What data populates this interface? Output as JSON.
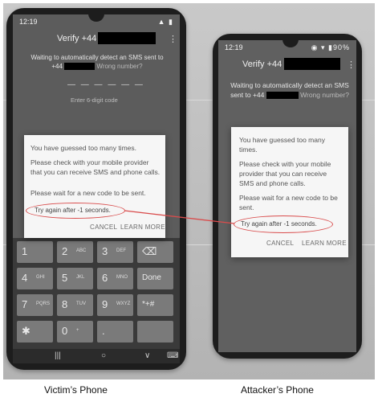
{
  "victim": {
    "status_time": "12:19",
    "status_icons": "▲ ▮",
    "verify_title": "Verify +44",
    "waiting_line1": "Waiting to automatically detect an SMS sent to",
    "waiting_prefix": "+44",
    "waiting_wrong": "Wrong number?",
    "code_dashes": "— — —   — — —",
    "code_hint": "Enter 6-digit code",
    "dialog": {
      "line1": "You have guessed too many times.",
      "line2": "Please check with your mobile provider that you can receive SMS and phone calls.",
      "line3": "Please wait for a new code to be sent.",
      "retry": "Try again after -1 seconds.",
      "cancel": "CANCEL",
      "learn_more": "LEARN MORE"
    },
    "keys": [
      {
        "d": "1",
        "l": ""
      },
      {
        "d": "2",
        "l": "ABC"
      },
      {
        "d": "3",
        "l": "DEF"
      },
      {
        "d": "⌫",
        "l": ""
      },
      {
        "d": "4",
        "l": "GHI"
      },
      {
        "d": "5",
        "l": "JKL"
      },
      {
        "d": "6",
        "l": "MNO"
      },
      {
        "d": "Done",
        "l": ""
      },
      {
        "d": "7",
        "l": "PQRS"
      },
      {
        "d": "8",
        "l": "TUV"
      },
      {
        "d": "9",
        "l": "WXYZ"
      },
      {
        "d": "*+#",
        "l": ""
      },
      {
        "d": "✱",
        "l": ""
      },
      {
        "d": "0",
        "l": "+"
      },
      {
        "d": ".",
        "l": ""
      },
      {
        "d": "",
        "l": ""
      }
    ],
    "nav": {
      "recents": "|||",
      "home": "○",
      "back": "∨",
      "keyboard": "⌨"
    }
  },
  "attacker": {
    "status_time": "12:19",
    "status_icons": "◉ ▾ ▮90%",
    "verify_title": "Verify +44",
    "waiting_line1": "Waiting to automatically detect an SMS",
    "waiting_prefix": "sent to +44",
    "waiting_wrong": "Wrong number?",
    "dialog": {
      "line1": "You have guessed too many times.",
      "line2": "Please check with your mobile provider that you can receive SMS and phone calls.",
      "line3": "Please wait for a new code to be sent.",
      "retry": "Try again after -1 seconds.",
      "cancel": "CANCEL",
      "learn_more": "LEARN MORE"
    }
  },
  "captions": {
    "victim": "Victim’s Phone",
    "attacker": "Attacker’s Phone"
  },
  "colors": {
    "annotation": "#d94c4c"
  }
}
